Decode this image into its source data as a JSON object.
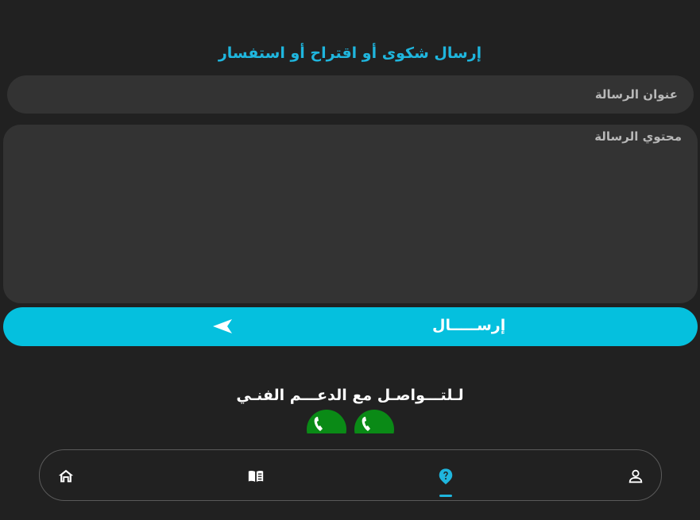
{
  "form": {
    "title": "إرسال شكوى أو اقتراح أو استفسار",
    "subject_placeholder": "عنوان الرسالة",
    "content_placeholder": "محتوي الرسالة",
    "send_label": "إرســـــال"
  },
  "support": {
    "title": "لـلتـــواصـل مع الدعـــم الفنـي",
    "phone_icons": [
      "phone-icon",
      "phone-icon"
    ]
  },
  "nav": {
    "items": [
      {
        "icon": "home-icon"
      },
      {
        "icon": "book-icon"
      },
      {
        "icon": "help-icon",
        "active": true
      },
      {
        "icon": "profile-icon"
      }
    ]
  },
  "colors": {
    "background": "#212121",
    "field": "#333333",
    "accent": "#05c0de",
    "title": "#1fb6de",
    "phone": "#0a8a16"
  }
}
